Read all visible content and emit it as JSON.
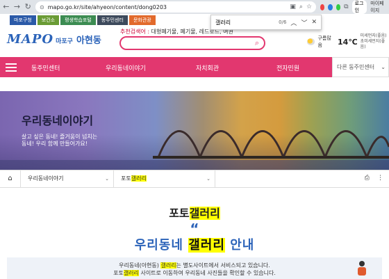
{
  "browser": {
    "url": "mapo.go.kr/site/ahyeon/content/dong0203",
    "login_label": "로그인",
    "profile_label": "마이페이지"
  },
  "find_bar": {
    "query": "갤러리",
    "count": "0/6"
  },
  "site_tabs": [
    {
      "label": "마포구청",
      "color": "#2b5aa8"
    },
    {
      "label": "보건소",
      "color": "#6a9b35"
    },
    {
      "label": "평생학습포털",
      "color": "#3c8c52"
    },
    {
      "label": "동주민센터",
      "color": "#3d4a5c"
    },
    {
      "label": "문화관광",
      "color": "#e26a2c"
    }
  ],
  "logo": {
    "mapo": "MAPO",
    "gu": "마포구",
    "dong": "아현동"
  },
  "recommend": {
    "label": "추천검색어 :",
    "words": "대형폐기물, 폐기물, 레드로드, 여권"
  },
  "weather": {
    "condition": "구름많음",
    "temp": "14℃",
    "dust_fine": "미세먼지(좋음)",
    "dust_ultra": "초미세먼지(좋음)"
  },
  "nav": {
    "items": [
      "동주민센터",
      "우리동네이야기",
      "자치회관",
      "전자민원"
    ],
    "dong_select": "다른 동주민센터"
  },
  "banner": {
    "title": "우리동네이야기",
    "subtitle_line1": "살고 싶은 동네! 즐거움이 넘치는",
    "subtitle_line2": "동네! 우리 함께 만들어가요!"
  },
  "breadcrumb": {
    "level1": "우리동네이야기",
    "level2_prefix": "포토",
    "level2_highlight": "갤러리"
  },
  "content": {
    "title_prefix": "포토",
    "title_highlight": "갤러리",
    "quote_mark": "“",
    "guide_prefix": "우리동네",
    "guide_highlight": "갤러리",
    "guide_suffix": "안내",
    "info_line1_prefix": "우리동네(아현동)",
    "info_line1_highlight": "갤러리",
    "info_line1_suffix": "는 별도사이트에서 서비스되고 있습니다.",
    "info_line2_prefix": "포토",
    "info_line2_highlight": "갤러리",
    "info_line2_suffix": "사이트로 이동하여 우리동네 사진들을 확인할 수 있습니다."
  }
}
